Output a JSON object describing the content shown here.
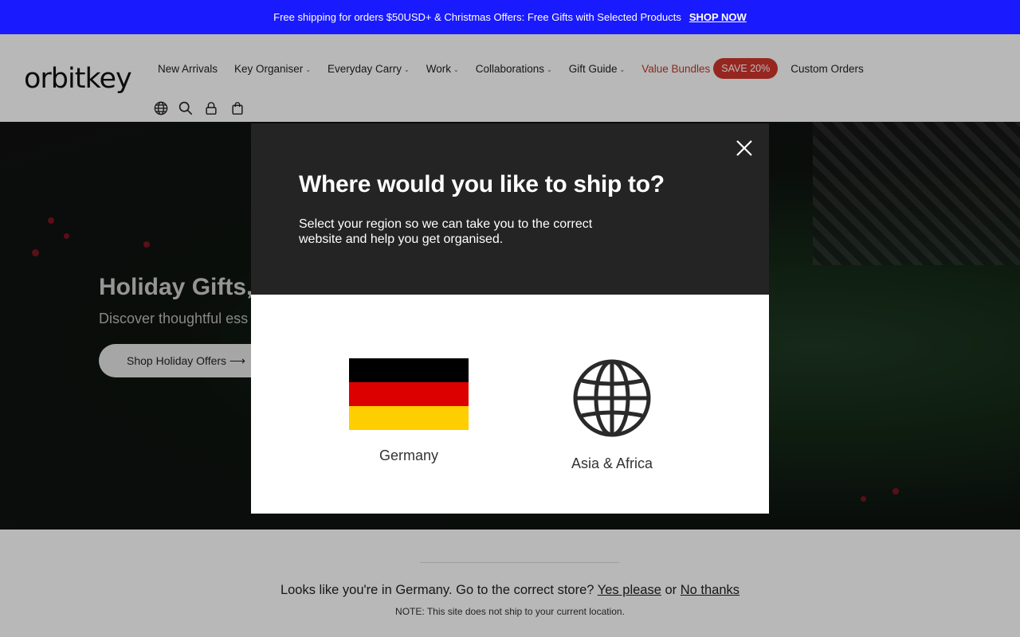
{
  "announcement": {
    "text": "Free shipping for orders $50USD+ & Christmas Offers: Free Gifts with Selected Products",
    "link": "SHOP NOW"
  },
  "header": {
    "logo": "orbitkey",
    "nav": [
      {
        "label": "New Arrivals",
        "dropdown": false
      },
      {
        "label": "Key Organiser",
        "dropdown": true
      },
      {
        "label": "Everyday Carry",
        "dropdown": true
      },
      {
        "label": "Work",
        "dropdown": true
      },
      {
        "label": "Collaborations",
        "dropdown": true
      },
      {
        "label": "Gift Guide",
        "dropdown": true
      }
    ],
    "value_bundles": "Value Bundles",
    "save_badge": "SAVE 20%",
    "custom_orders": "Custom Orders",
    "icons": [
      "globe-icon",
      "search-icon",
      "account-icon",
      "cart-icon"
    ]
  },
  "hero": {
    "title": "Holiday Gifts,",
    "subtitle": "Discover thoughtful ess",
    "button": "Shop Holiday Offers ⟶"
  },
  "modal": {
    "title": "Where would you like to ship to?",
    "description": "Select your region so we can take you to the correct website and help you get organised.",
    "regions": [
      {
        "label": "Germany",
        "icon": "germany-flag"
      },
      {
        "label": "Asia & Africa",
        "icon": "globe-icon"
      }
    ]
  },
  "geo_bar": {
    "message": "Looks like you're in Germany. Go to the correct store?",
    "yes": "Yes please",
    "or": "or",
    "no": "No thanks",
    "note": "NOTE: This site does not ship to your current location."
  },
  "colors": {
    "announcement_bg": "#1a1aff",
    "sale_red": "#d0352d",
    "modal_dark": "#242424",
    "flag_black": "#000000",
    "flag_red": "#dd0000",
    "flag_gold": "#ffce00"
  }
}
